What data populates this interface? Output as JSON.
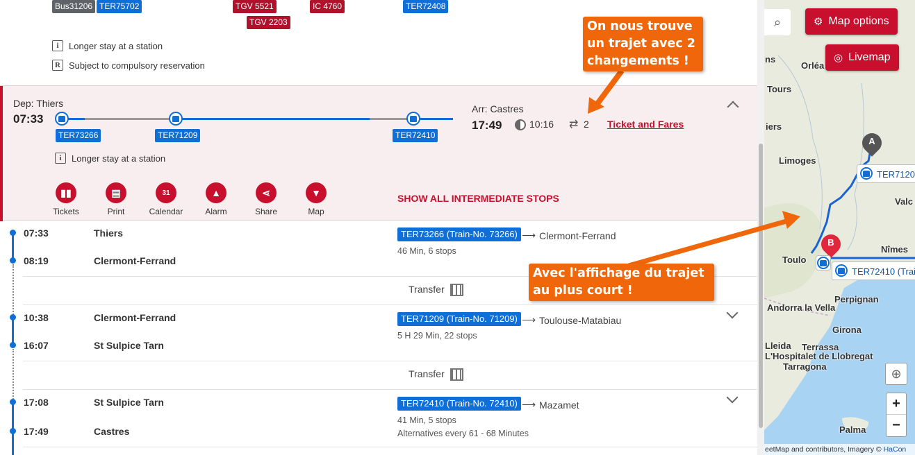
{
  "top": {
    "badges_row1": [
      "Bus31206",
      "TER75702",
      "TGV 5521",
      "IC 4760",
      "TER72408"
    ],
    "badges_row2": [
      "TGV 2203"
    ],
    "notes": [
      "Longer stay at a station",
      "Subject to compulsory reservation"
    ],
    "note_icons": [
      "i",
      "R"
    ]
  },
  "journey": {
    "dep_label": "Dep: Thiers",
    "dep_time": "07:33",
    "arr_label": "Arr: Castres",
    "arr_time": "17:49",
    "duration": "10:16",
    "changes": "2",
    "ticket_link": "Ticket and Fares",
    "trains": [
      "TER73266",
      "TER71209",
      "TER72410"
    ],
    "note": "Longer stay at a station",
    "note_icon": "i",
    "actions": [
      "Tickets",
      "Print",
      "Calendar",
      "Alarm",
      "Share",
      "Map"
    ],
    "calendar_day": "31",
    "show_stops": "SHOW ALL INTERMEDIATE STOPS",
    "accent": "#c8102e",
    "line_color": "#0f6fd6"
  },
  "legs": [
    {
      "dep_time": "07:33",
      "dep_station": "Thiers",
      "arr_time": "08:19",
      "arr_station": "Clermont-Ferrand",
      "train": "TER73266 (Train-No. 73266)",
      "direction": "Clermont-Ferrand",
      "info": "46 Min, 6 stops"
    },
    {
      "dep_time": "10:38",
      "dep_station": "Clermont-Ferrand",
      "arr_time": "16:07",
      "arr_station": "St Sulpice Tarn",
      "train": "TER71209 (Train-No. 71209)",
      "direction": "Toulouse-Matabiau",
      "info": "5 H 29 Min, 22 stops"
    },
    {
      "dep_time": "17:08",
      "dep_station": "St Sulpice Tarn",
      "arr_time": "17:49",
      "arr_station": "Castres",
      "train": "TER72410 (Train-No. 72410)",
      "direction": "Mazamet",
      "info": "41 Min, 5 stops",
      "extra": "Alternatives every 61 - 68 Minutes"
    }
  ],
  "transfer_label": "Transfer",
  "arrow_glyph": "⟶",
  "map": {
    "options_label": "Map options",
    "livemap_label": "Livemap",
    "labels": [
      "ns",
      "Orléa",
      "Tours",
      "iers",
      "Limoges",
      "Valc",
      "Toulo",
      "Nîmes",
      "Perpignan",
      "Andorra la Vella",
      "Girona",
      "Lleida",
      "Terrassa",
      "L'Hospitalet de Llobregat",
      "Tarragona",
      "Palma"
    ],
    "marker_a": "A",
    "marker_b": "B",
    "train_labels": [
      "TER7120",
      "TER72410 (Trai"
    ],
    "zoom_in": "+",
    "zoom_out": "−",
    "attribution": "eetMap and contributors, Imagery © ",
    "attribution_link": "HaCon"
  },
  "annotations": {
    "callout1": "On nous trouve un trajet avec 2 changements !",
    "callout2": "Avec l'affichage du trajet au plus court !",
    "color": "#f0660a"
  }
}
